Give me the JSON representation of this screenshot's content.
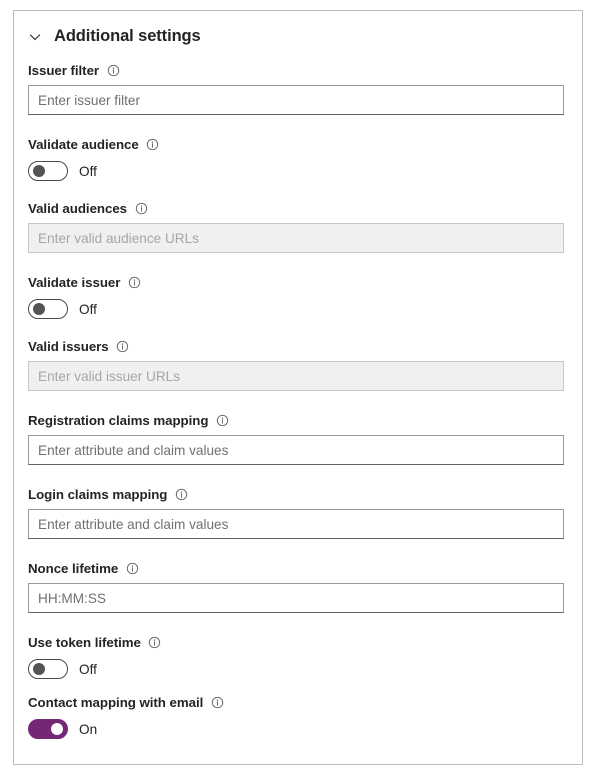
{
  "colors": {
    "accent_on": "#742774",
    "toggle_off_border": "#4a4a4a",
    "toggle_off_knob": "#545454",
    "card_border": "#bdbdbd",
    "input_border": "#9a9a9a",
    "input_disabled_bg": "#f0f0f0",
    "text": "#242424",
    "placeholder": "#707070"
  },
  "section": {
    "title": "Additional settings",
    "chevron_icon": "chevron-down-icon",
    "expanded": true
  },
  "icons": {
    "info": "info-icon"
  },
  "fields": {
    "issuer_filter": {
      "label": "Issuer filter",
      "type": "text",
      "placeholder": "Enter issuer filter",
      "value": "",
      "disabled": false,
      "info": "info-icon"
    },
    "validate_audience": {
      "label": "Validate audience",
      "type": "toggle",
      "state": "Off",
      "on": false,
      "info": "info-icon"
    },
    "valid_audiences": {
      "label": "Valid audiences",
      "type": "text",
      "placeholder": "Enter valid audience URLs",
      "value": "",
      "disabled": true,
      "info": "info-icon"
    },
    "validate_issuer": {
      "label": "Validate issuer",
      "type": "toggle",
      "state": "Off",
      "on": false,
      "info": "info-icon"
    },
    "valid_issuers": {
      "label": "Valid issuers",
      "type": "text",
      "placeholder": "Enter valid issuer URLs",
      "value": "",
      "disabled": true,
      "info": "info-icon"
    },
    "registration_claims_mapping": {
      "label": "Registration claims mapping",
      "type": "text",
      "placeholder": "Enter attribute and claim values",
      "value": "",
      "disabled": false,
      "info": "info-icon"
    },
    "login_claims_mapping": {
      "label": "Login claims mapping",
      "type": "text",
      "placeholder": "Enter attribute and claim values",
      "value": "",
      "disabled": false,
      "info": "info-icon"
    },
    "nonce_lifetime": {
      "label": "Nonce lifetime",
      "type": "text",
      "placeholder": "HH:MM:SS",
      "value": "",
      "disabled": false,
      "info": "info-icon"
    },
    "use_token_lifetime": {
      "label": "Use token lifetime",
      "type": "toggle",
      "state": "Off",
      "on": false,
      "info": "info-icon"
    },
    "contact_mapping_with_email": {
      "label": "Contact mapping with email",
      "type": "toggle",
      "state": "On",
      "on": true,
      "info": "info-icon"
    }
  }
}
